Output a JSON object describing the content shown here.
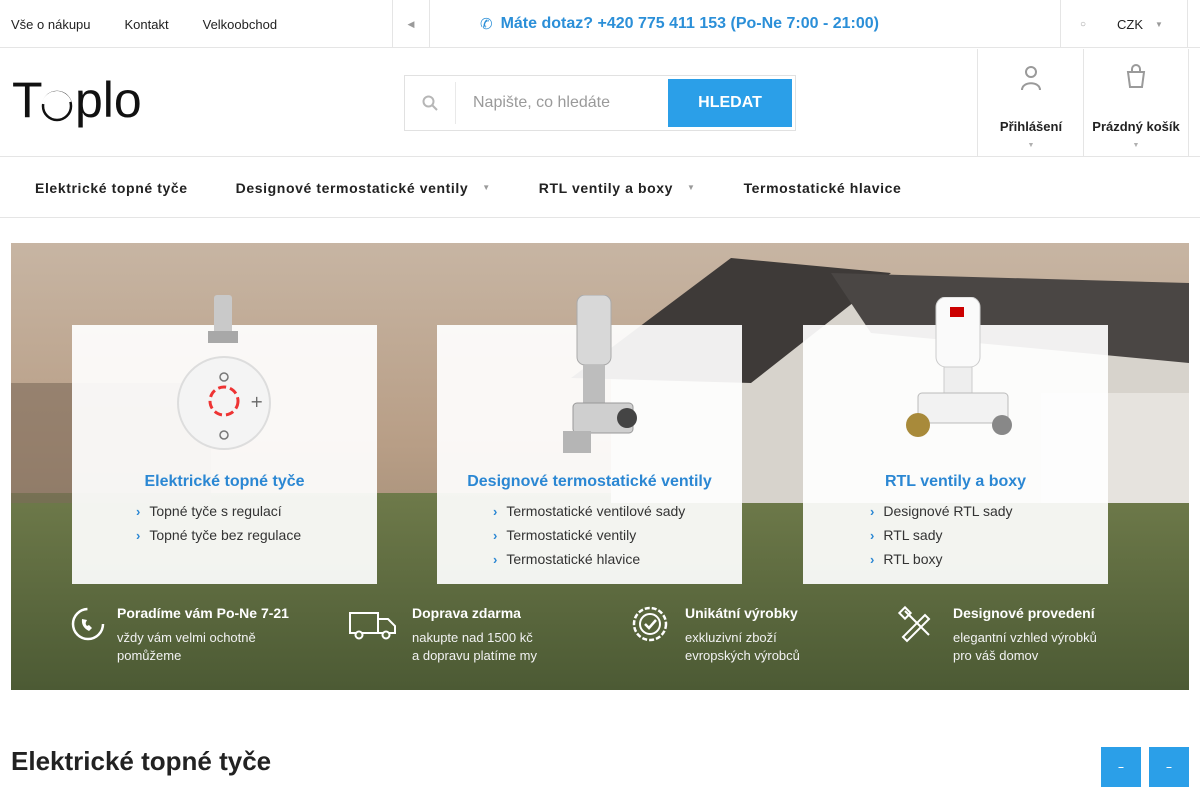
{
  "topbar": {
    "links": [
      "Vše o nákupu",
      "Kontakt",
      "Velkoobchod"
    ],
    "more_icon": "caret-left-icon",
    "hotline": "Máte dotaz? +420 775 411 153 (Po-Ne 7:00 - 21:00)",
    "hotline_icon": "phone-icon",
    "currency": "CZK"
  },
  "header": {
    "logo_text": "Toplo",
    "search_placeholder": "Napište, co hledáte",
    "search_button": "HLEDAT",
    "login_label": "Přihlášení",
    "cart_label": "Prázdný košík"
  },
  "nav": {
    "items": [
      {
        "label": "Elektrické topné tyče",
        "has_submenu": false
      },
      {
        "label": "Designové termostatické ventily",
        "has_submenu": true
      },
      {
        "label": "RTL ventily a boxy",
        "has_submenu": true
      },
      {
        "label": "Termostatické hlavice",
        "has_submenu": false
      }
    ]
  },
  "banner": {
    "cards": [
      {
        "title": "Elektrické topné tyče",
        "items": [
          "Topné tyče s regulací",
          "Topné tyče bez regulace"
        ]
      },
      {
        "title": "Designové termostatické ventily",
        "items": [
          "Termostatické ventilové sady",
          "Termostatické ventily",
          "Termostatické hlavice"
        ]
      },
      {
        "title": "RTL ventily a boxy",
        "items": [
          "Designové RTL sady",
          "RTL sady",
          "RTL boxy"
        ]
      }
    ],
    "features": [
      {
        "title": "Poradíme vám Po-Ne 7-21",
        "line1": "vždy vám velmi ochotně",
        "line2": "pomůžeme",
        "icon": "phone-support-icon"
      },
      {
        "title": "Doprava zdarma",
        "line1": "nakupte nad 1500 kč",
        "line2": "a dopravu platíme my",
        "icon": "truck-icon"
      },
      {
        "title": "Unikátní výrobky",
        "line1": "exkluzivní zboží",
        "line2": "evropských výrobců",
        "icon": "check-badge-icon"
      },
      {
        "title": "Designové provedení",
        "line1": "elegantní vzhled výrobků",
        "line2": "pro váš domov",
        "icon": "design-tools-icon"
      }
    ]
  },
  "section": {
    "title": "Elektrické topné tyče"
  },
  "colors": {
    "accent": "#2b9fe8",
    "hotline": "#2b8fd8",
    "banner_heading": "#2b87d3"
  }
}
